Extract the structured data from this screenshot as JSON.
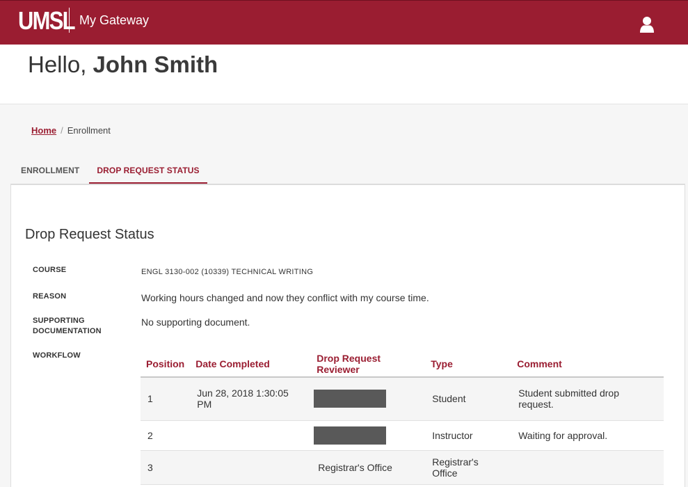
{
  "header": {
    "logo_text": "UMSL",
    "app_name": "My Gateway",
    "user_icon": "user-icon",
    "brand_color": "#9a1d31"
  },
  "hero": {
    "greeting_prefix": "Hello,",
    "user_name": "John Smith"
  },
  "breadcrumb": {
    "home": "Home",
    "separator": "/",
    "current": "Enrollment"
  },
  "tabs": [
    {
      "label": "ENROLLMENT",
      "active": false
    },
    {
      "label": "DROP REQUEST STATUS",
      "active": true
    }
  ],
  "drop_request": {
    "title": "Drop Request Status",
    "fields": {
      "course_label": "COURSE",
      "course_value": "ENGL 3130-002 (10339) TECHNICAL WRITING",
      "reason_label": "REASON",
      "reason_value": "Working hours changed and now they conflict with my course time.",
      "docs_label_line1": "SUPPORTING",
      "docs_label_line2": "DOCUMENTATION",
      "docs_value": "No supporting document.",
      "workflow_label": "WORKFLOW"
    },
    "workflow": {
      "columns": [
        "Position",
        "Date Completed",
        "Drop Request Reviewer",
        "Type",
        "Comment"
      ],
      "rows": [
        {
          "position": "1",
          "date_line1": "Jun 28, 2018 1:30:05",
          "date_line2": "PM",
          "reviewer": "",
          "reviewer_redacted": true,
          "type": "Student",
          "comment": "Student submitted drop request."
        },
        {
          "position": "2",
          "date_line1": "",
          "date_line2": "",
          "reviewer": "",
          "reviewer_redacted": true,
          "type": "Instructor",
          "comment": "Waiting for approval."
        },
        {
          "position": "3",
          "date_line1": "",
          "date_line2": "",
          "reviewer": "Registrar's Office",
          "reviewer_redacted": false,
          "type": "Registrar's Office",
          "comment": ""
        }
      ]
    }
  }
}
